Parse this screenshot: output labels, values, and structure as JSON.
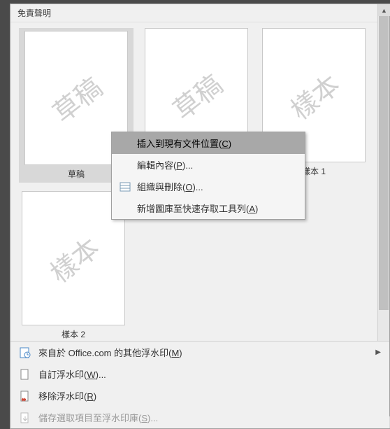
{
  "section": {
    "title": "免責聲明"
  },
  "gallery": {
    "items": [
      {
        "watermark": "草稿",
        "label": "草稿",
        "selected": true
      },
      {
        "watermark": "草稿",
        "label": ""
      },
      {
        "watermark": "樣本",
        "label": "樣本 1"
      },
      {
        "watermark": "樣本",
        "label": "樣本 2"
      }
    ]
  },
  "context_menu": {
    "items": [
      {
        "label": "插入到現有文件位置(",
        "hotkey": "C",
        "suffix": ")"
      },
      {
        "label": "編輯內容(",
        "hotkey": "P",
        "suffix": ")..."
      },
      {
        "label": "組織與刪除(",
        "hotkey": "O",
        "suffix": ")..."
      },
      {
        "label": "新增圖庫至快速存取工具列(",
        "hotkey": "A",
        "suffix": ")"
      }
    ]
  },
  "bottom_menu": {
    "items": [
      {
        "label": "來自於 Office.com 的其他浮水印(",
        "hotkey": "M",
        "suffix": ")",
        "has_submenu": true
      },
      {
        "label": "自訂浮水印(",
        "hotkey": "W",
        "suffix": ")..."
      },
      {
        "label": "移除浮水印(",
        "hotkey": "R",
        "suffix": ")"
      },
      {
        "label": "儲存選取項目至浮水印庫(",
        "hotkey": "S",
        "suffix": ")...",
        "disabled": true
      }
    ]
  }
}
